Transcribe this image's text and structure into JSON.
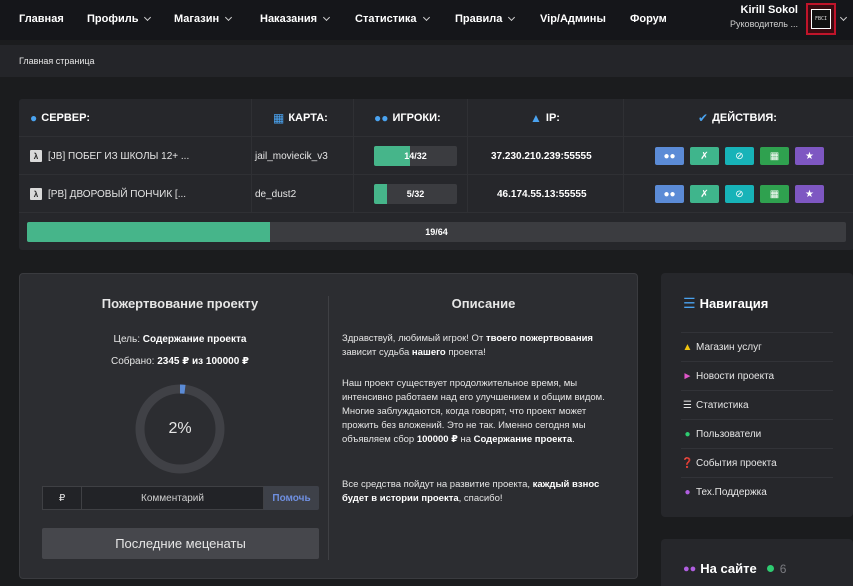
{
  "nav": {
    "items": [
      {
        "label": "Главная",
        "dropdown": false
      },
      {
        "label": "Профиль",
        "dropdown": true
      },
      {
        "label": "Магазин",
        "dropdown": true
      },
      {
        "label": "Наказания",
        "dropdown": true
      },
      {
        "label": "Статистика",
        "dropdown": true
      },
      {
        "label": "Правила",
        "dropdown": true
      },
      {
        "label": "Vip/Админы",
        "dropdown": false
      },
      {
        "label": "Форум",
        "dropdown": false
      }
    ],
    "user": {
      "name": "Kirill Sokol",
      "role": "Руководитель ...",
      "avatar_text": "FBCI"
    }
  },
  "breadcrumb": "Главная страница",
  "servers": {
    "headers": {
      "server": "СЕРВЕР:",
      "map": "КАРТА:",
      "players": "ИГРОКИ:",
      "ip": "IP:",
      "actions": "ДЕЙСТВИЯ:"
    },
    "rows": [
      {
        "name": "[JB] ПОБЕГ ИЗ ШКОЛЫ 12+ ...",
        "map": "jail_moviecik_v3",
        "players": "14/32",
        "players_fraction": 0.4375,
        "ip": "37.230.210.239:55555"
      },
      {
        "name": "[PB] ДВОРОВЫЙ ПОНЧИК [...",
        "map": "de_dust2",
        "players": "5/32",
        "players_fraction": 0.15625,
        "ip": "46.174.55.13:55555"
      }
    ],
    "actions": [
      {
        "icon": "users-icon",
        "color": "#5b8bd6"
      },
      {
        "icon": "user-slash-icon",
        "color": "#3fb58c"
      },
      {
        "icon": "ban-icon",
        "color": "#17b3b8"
      },
      {
        "icon": "calendar-icon",
        "color": "#2fa14f"
      },
      {
        "icon": "trophy-icon",
        "color": "#7e57c2"
      }
    ],
    "total": "19/64",
    "total_fraction": 0.296875
  },
  "donate": {
    "title": "Пожертвование проекту",
    "goal_label": "Цель:",
    "goal_value": "Содержание проекта",
    "collected_label": "Собрано:",
    "collected_value": "2345 ₽ из 100000 ₽",
    "percent": 2,
    "percent_label": "2%",
    "currency": "₽",
    "comment_placeholder": "Комментарий",
    "help_label": "Помочь",
    "patrons_label": "Последние меценаты"
  },
  "description": {
    "title": "Описание",
    "p1_a": "Здравствуй, любимый игрок! От ",
    "p1_b": "твоего пожертвования",
    "p1_c": " зависит судьба ",
    "p1_d": "нашего",
    "p1_e": " проекта!",
    "p2_a": "Наш проект существует продолжительное время, мы интенсивно работаем над его улучшением и общим видом. Многие заблуждаются, когда говорят, что проект может прожить без вложений. Это не так. Именно сегодня мы объявляем сбор ",
    "p2_b": "100000 ₽",
    "p2_c": " на ",
    "p2_d": "Содержание проекта",
    "p2_e": ".",
    "p3_a": "Все средства пойдут на развитие проекта, ",
    "p3_b": "каждый взнос будет в истории проекта",
    "p3_c": ", спасибо!"
  },
  "sidebar": {
    "title": "Навигация",
    "items": [
      {
        "label": "Магазин услуг",
        "icon": "basket-icon",
        "color": "#f1c40f"
      },
      {
        "label": "Новости проекта",
        "icon": "bullhorn-icon",
        "color": "#e056c8"
      },
      {
        "label": "Статистика",
        "icon": "server-icon",
        "color": "#e6e6e6"
      },
      {
        "label": "Пользователи",
        "icon": "user-icon",
        "color": "#2ecc71"
      },
      {
        "label": "События проекта",
        "icon": "question-icon",
        "color": "#3aa0e8"
      },
      {
        "label": "Тех.Поддержка",
        "icon": "users-icon",
        "color": "#b05ee0"
      }
    ]
  },
  "online": {
    "title": "На сайте",
    "count": "6"
  }
}
